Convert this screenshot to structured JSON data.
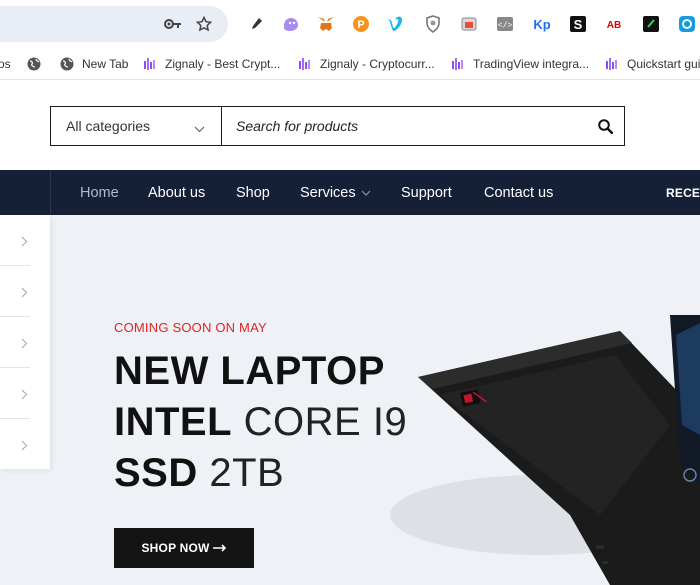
{
  "browser": {
    "extensions": [
      "eyedropper-icon",
      "ghost-extension-icon",
      "metamask-icon",
      "bitcoin-extension-icon",
      "vimeo-icon",
      "shield-extension-icon",
      "screenshot-extension-icon",
      "code-extension-icon",
      "kp-extension-icon",
      "s-extension-icon",
      "ab-extension-icon",
      "terminal-extension-icon",
      "refresh-extension-icon"
    ],
    "colors": {
      "omnibox": "#e9eef6"
    }
  },
  "bookmarks": [
    {
      "label": "os",
      "icon": "globe-icon"
    },
    {
      "label": "New Tab",
      "icon": "globe-icon"
    },
    {
      "label": "Zignaly - Best Crypt...",
      "icon": "zignaly-icon"
    },
    {
      "label": "Zignaly - Cryptocurr...",
      "icon": "zignaly-icon"
    },
    {
      "label": "TradingView integra...",
      "icon": "zignaly-icon"
    },
    {
      "label": "Quickstart gui",
      "icon": "zignaly-icon"
    }
  ],
  "search": {
    "category": "All categories",
    "placeholder": "Search for products"
  },
  "nav": {
    "items": [
      "Home",
      "About us",
      "Shop",
      "Services",
      "Support",
      "Contact us"
    ],
    "right": "RECEN",
    "colors": {
      "bar": "#152036"
    }
  },
  "hero": {
    "tag": "COMING SOON ON MAY",
    "line1_bold": "NEW LAPTOP",
    "line2_bold": "INTEL",
    "line2_light": "CORE I9",
    "line3_bold": "SSD",
    "line3_light": "2TB",
    "button": "SHOP NOW",
    "colors": {
      "tag": "#e02424",
      "background": "#eef1f5"
    }
  }
}
